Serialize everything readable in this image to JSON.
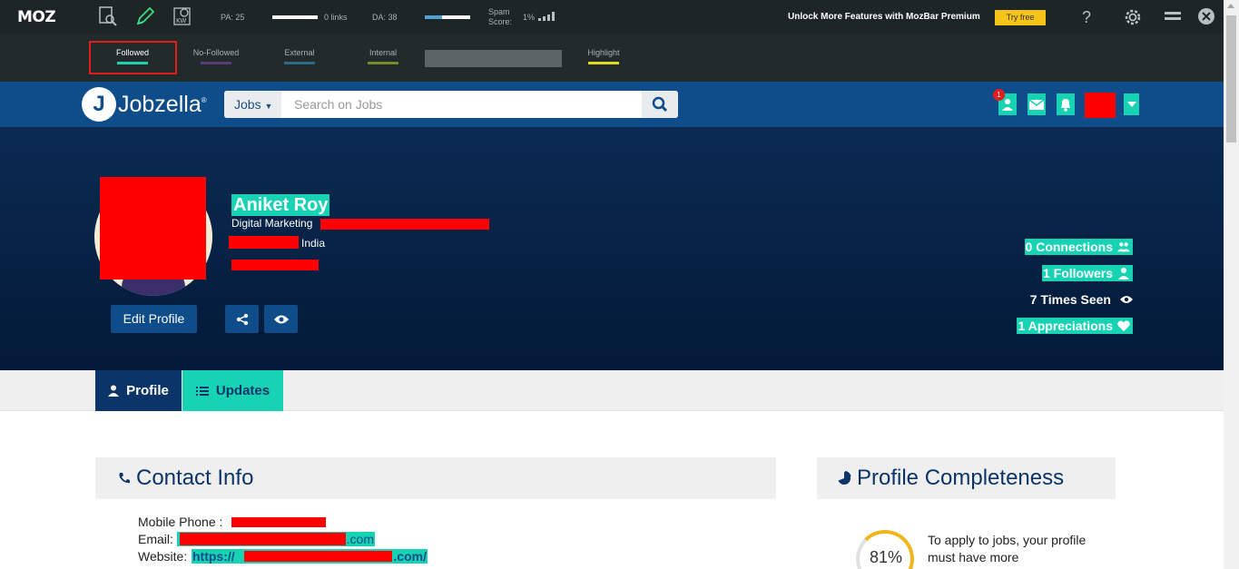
{
  "mozbar": {
    "logo": "MOZ",
    "pa_label": "PA: 25",
    "links_label": "0 links",
    "da_label": "DA: 38",
    "da_fraction": 0.38,
    "spam_label_1": "Spam",
    "spam_label_2": "Score:",
    "spam_value": "1%",
    "premium_text": "Unlock More Features with MozBar Premium",
    "try_label": "Try free",
    "help_label": "?"
  },
  "link_filters": {
    "followed": "Followed",
    "nofollowed": "No-Followed",
    "external": "External",
    "internal": "Internal",
    "highlight": "Highlight"
  },
  "header": {
    "logo_text": "Jobzella",
    "logo_mark": "®",
    "search_category": "Jobs",
    "search_placeholder": "Search on Jobs",
    "notification_count": "1"
  },
  "profile": {
    "name": "Aniket Roy",
    "title": "Digital Marketing",
    "location": "India",
    "edit_label": "Edit Profile"
  },
  "stats": {
    "connections": "0 Connections",
    "followers": "1 Followers",
    "times_seen": "7 Times Seen",
    "appreciations": "1 Appreciations"
  },
  "tabs": {
    "profile": "Profile",
    "updates": "Updates"
  },
  "contact": {
    "heading": "Contact Info",
    "mobile_label": "Mobile Phone :",
    "email_label": "Email:",
    "email_suffix": ".com",
    "website_label": "Website:",
    "website_prefix": "https://",
    "website_suffix": ".com/"
  },
  "completeness": {
    "heading": "Profile Completeness",
    "percent": "81%",
    "text": "To apply to jobs, your profile must have more"
  },
  "colors": {
    "moz_bg": "#1e2526",
    "header_blue": "#0e4c8a",
    "accent_teal": "#17d2b3",
    "navy": "#0b3568",
    "redaction": "#ff0000"
  }
}
